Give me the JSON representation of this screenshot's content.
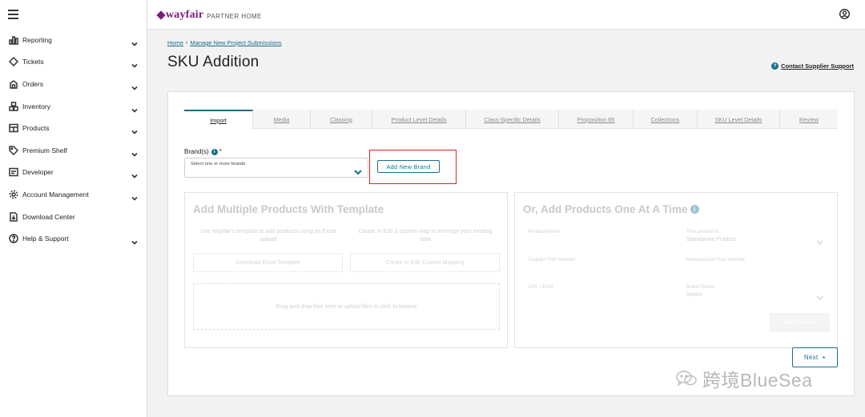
{
  "sidebar": {
    "items": [
      {
        "label": "Reporting",
        "icon": "bar-chart-icon",
        "expandable": true
      },
      {
        "label": "Tickets",
        "icon": "ticket-icon",
        "expandable": true
      },
      {
        "label": "Orders",
        "icon": "orders-icon",
        "expandable": true
      },
      {
        "label": "Inventory",
        "icon": "inventory-icon",
        "expandable": true
      },
      {
        "label": "Products",
        "icon": "products-icon",
        "expandable": true
      },
      {
        "label": "Premium Shelf",
        "icon": "tag-icon",
        "expandable": true
      },
      {
        "label": "Developer",
        "icon": "developer-icon",
        "expandable": true
      },
      {
        "label": "Account Management",
        "icon": "gear-icon",
        "expandable": true
      },
      {
        "label": "Download Center",
        "icon": "download-icon",
        "expandable": false
      },
      {
        "label": "Help & Support",
        "icon": "help-icon",
        "expandable": true
      }
    ]
  },
  "header": {
    "logo_word": "wayfair",
    "logo_sub": "PARTNER HOME"
  },
  "breadcrumb": {
    "home": "Home",
    "separator": "›",
    "current": "Manage New Project Submissions"
  },
  "page": {
    "title": "SKU Addition",
    "support_link": "Contact Supplier Support",
    "support_icon": "?"
  },
  "tabs": [
    "Import",
    "Media",
    "Classing",
    "Product Level Details",
    "Class-Specific Details",
    "Proposition 65",
    "Collections",
    "SKU Level Details",
    "Review"
  ],
  "brand": {
    "label": "Brand(s)",
    "required_mark": "*",
    "info_icon": "i",
    "placeholder": "Select one or more brands",
    "add_button": "Add New Brand"
  },
  "left_panel": {
    "title": "Add Multiple Products With Template",
    "col1_text": "Use Wayfair's template to add products using an Excel upload",
    "col2_text": "Create or Edit a custom map to leverage your existing data",
    "btn1": "Download Excel Template",
    "btn2": "Create or Edit Custom Mapping",
    "dropzone": "Drag and drop files here to upload files or click to browse"
  },
  "right_panel": {
    "title": "Or, Add Products One At A Time",
    "info_icon": "i",
    "field_product_name": "Product Name",
    "field_product_is": "This product is",
    "field_product_is_value": "Standalone Product",
    "field_supplier_part": "Supplier Part Number",
    "field_manufacturer_part": "Manufacturer Part Number",
    "field_upc": "UPC / EAN",
    "field_brand_name": "Brand Name",
    "field_brand_name_value": "Select",
    "add_button": "Add Product"
  },
  "footer": {
    "next": "Next",
    "next_arrow": "▸"
  },
  "watermark": "跨境BlueSea",
  "colors": {
    "accent": "#1a6d8a",
    "brand": "#7f187f",
    "highlight": "#e02020"
  }
}
